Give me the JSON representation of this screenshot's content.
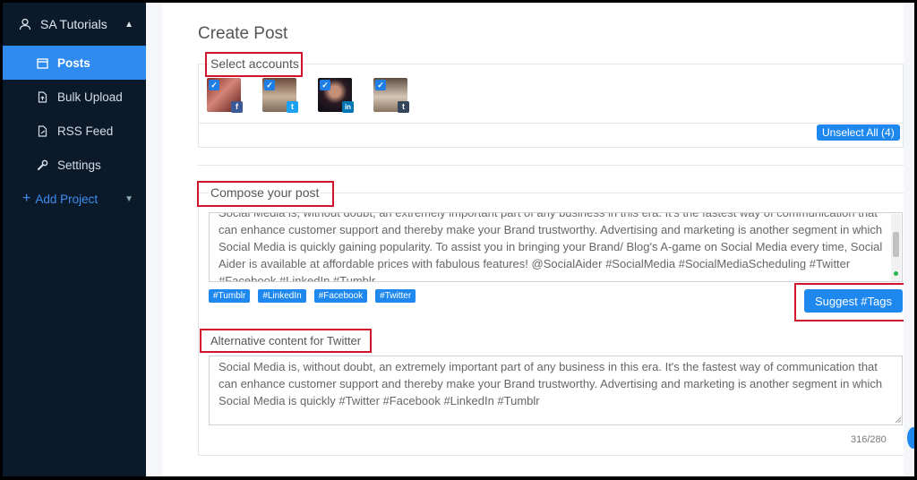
{
  "sidebar": {
    "project_name": "SA Tutorials",
    "items": [
      {
        "label": "Posts",
        "icon": "calendar-icon"
      },
      {
        "label": "Bulk Upload",
        "icon": "file-upload-icon"
      },
      {
        "label": "RSS Feed",
        "icon": "file-icon"
      },
      {
        "label": "Settings",
        "icon": "wrench-icon"
      }
    ],
    "add_project_label": "Add Project"
  },
  "main": {
    "page_title": "Create Post",
    "select_accounts_label": "Select accounts",
    "accounts": [
      {
        "network": "facebook",
        "network_glyph": "f",
        "checked": true
      },
      {
        "network": "twitter",
        "network_glyph": "t",
        "checked": true
      },
      {
        "network": "linkedin",
        "network_glyph": "in",
        "checked": true
      },
      {
        "network": "tumblr",
        "network_glyph": "t",
        "checked": true
      }
    ],
    "unselect_all_label": "Unselect All (4)",
    "compose_label": "Compose your post",
    "compose_text": "Social Media is, without doubt, an extremely important part of any business in this era. It's the fastest way of communication that can enhance customer support and thereby make your Brand trustworthy. Advertising and marketing is another segment in which Social Media is quickly gaining popularity. To assist you in bringing your Brand/ Blog's A-game on Social Media every time, Social Aider is available at affordable prices with fabulous features! @SocialAider #SocialMedia #SocialMediaScheduling #Twitter #Facebook #LinkedIn #Tumblr",
    "tags": [
      "#Tumblr",
      "#LinkedIn",
      "#Facebook",
      "#Twitter"
    ],
    "suggest_tags_label": "Suggest #Tags",
    "alt_twitter_label": "Alternative content for Twitter",
    "alt_twitter_text": "Social Media is, without doubt, an extremely important part of any business in this era. It's the fastest way of communication that can enhance customer support and thereby make your Brand trustworthy. Advertising and marketing is another segment in which Social Media is quickly #Twitter #Facebook #LinkedIn #Tumblr",
    "char_counter": "316/280"
  },
  "colors": {
    "sidebar_bg": "#0b1a2b",
    "accent": "#1e88ef",
    "highlight_border": "#d0142c",
    "facebook": "#3b5998",
    "twitter": "#1da1f2",
    "linkedin": "#0077b5",
    "tumblr": "#35465c"
  }
}
